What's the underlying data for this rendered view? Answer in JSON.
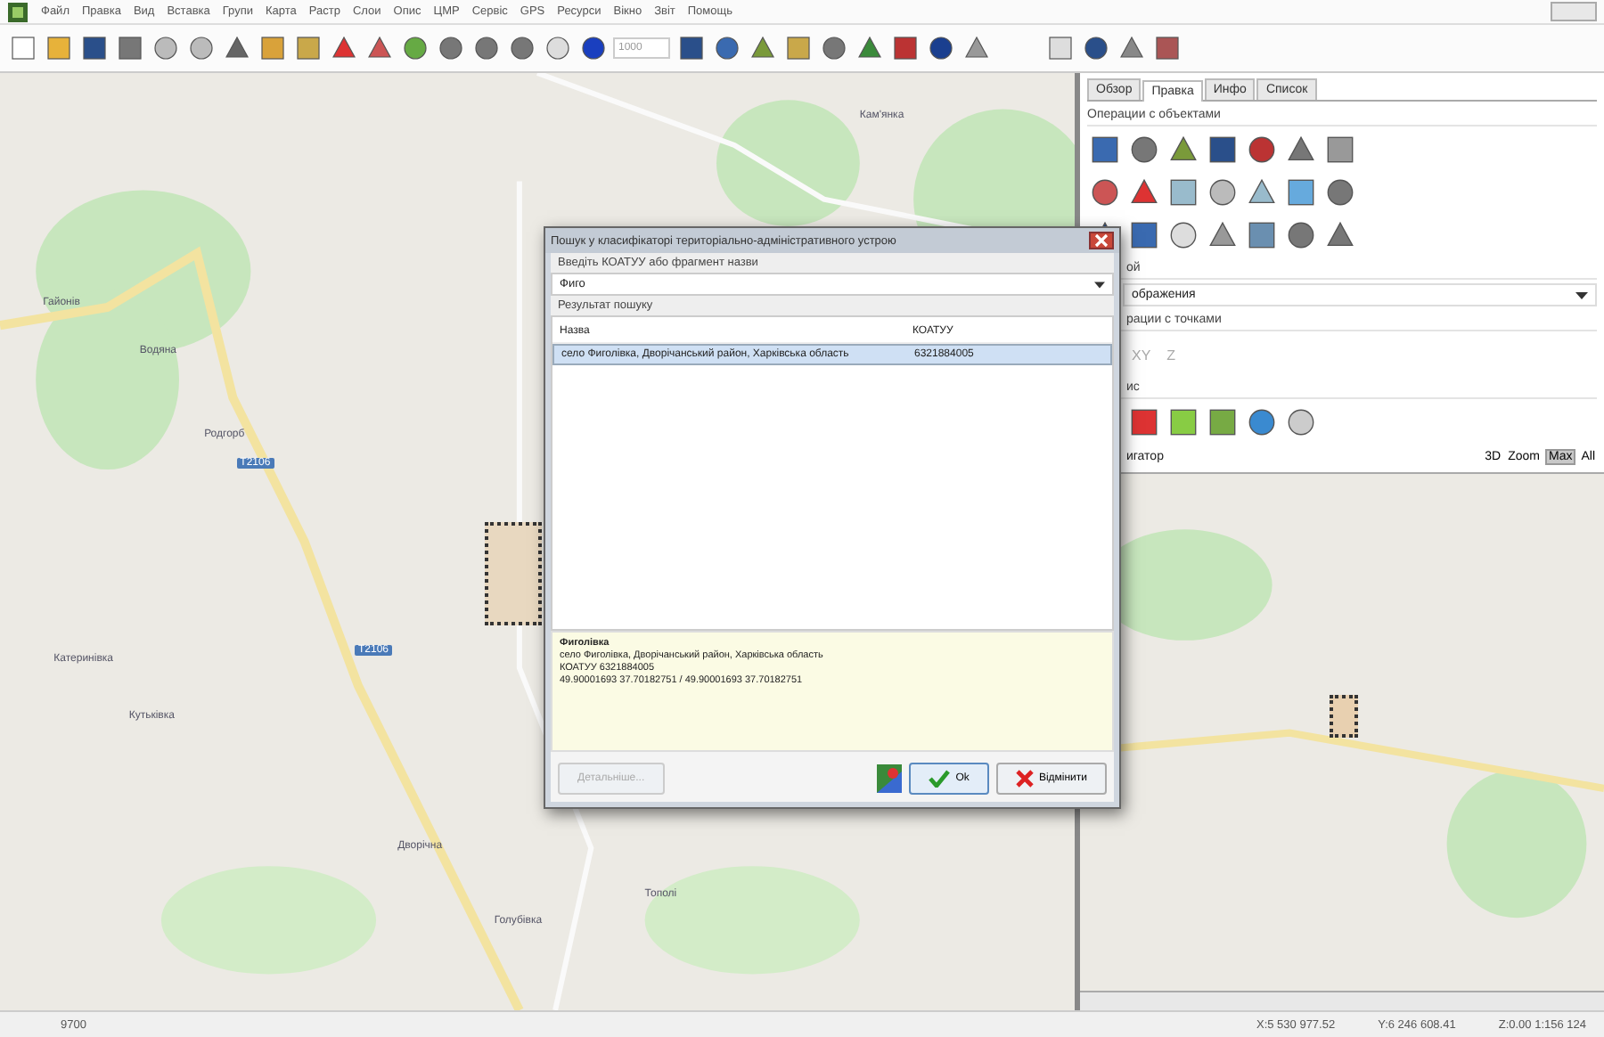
{
  "menu": [
    "Файл",
    "Правка",
    "Вид",
    "Вставка",
    "Групи",
    "Карта",
    "Растр",
    "Слои",
    "Опис",
    "ЦМР",
    "Сервіс",
    "GPS",
    "Ресурси",
    "Вікно",
    "Звіт",
    "Помощь"
  ],
  "toolbar": {
    "scale_field": {
      "value": "1000"
    }
  },
  "map": {
    "labels": [
      {
        "text": "Кам'янка",
        "kind": "place"
      },
      {
        "text": "Гайонів",
        "kind": "place"
      },
      {
        "text": "Водяна",
        "kind": "place"
      },
      {
        "text": "Родгорб",
        "kind": "place"
      },
      {
        "text": "Т2106",
        "kind": "road"
      },
      {
        "text": "Т2106",
        "kind": "road"
      },
      {
        "text": "Катеринівка",
        "kind": "place"
      },
      {
        "text": "Кутьківка",
        "kind": "place"
      },
      {
        "text": "Дворічна",
        "kind": "place"
      },
      {
        "text": "Тополі",
        "kind": "place"
      },
      {
        "text": "Голубівка",
        "kind": "place"
      }
    ]
  },
  "dialog": {
    "title": "Пошук у класифікаторі територіально-адміністративного устрою",
    "input_label": "Введіть КОАТУУ або фрагмент назви",
    "input": {
      "value": "Фиго"
    },
    "results_label": "Результат пошуку",
    "table": {
      "columns": [
        "Назва",
        "КОАТУУ"
      ],
      "rows": [
        {
          "cells": [
            "село Фиголівка, Дворічанський район, Харківська область",
            "6321884005"
          ],
          "selected": true
        }
      ]
    },
    "info": {
      "title": "Фиголівка",
      "lines": [
        "село Фиголівка, Дворічанський район, Харківська область",
        "КОАТУУ 6321884005",
        "49.90001693 37.70182751 / 49.90001693 37.70182751"
      ]
    },
    "buttons": [
      {
        "label": "Детальніше...",
        "kind": "details",
        "disabled": true
      },
      {
        "label": "Ok",
        "kind": "ok",
        "disabled": false
      },
      {
        "label": "Відмінити",
        "kind": "cancel",
        "disabled": false
      }
    ]
  },
  "panel": {
    "tabs": [
      {
        "label": "Обзор",
        "selected": false
      },
      {
        "label": "Правка",
        "selected": true
      },
      {
        "label": "Инфо",
        "selected": false
      },
      {
        "label": "Список",
        "selected": false
      }
    ],
    "objects_label": "Операции с объектами",
    "layer_label": "ой",
    "layer_value": "ображения",
    "points_label": "рации с точками",
    "points_texts": [
      "XY",
      "Z"
    ],
    "service_label": "ис",
    "navigator_label": "игатор",
    "nav_buttons": [
      {
        "label": "3D",
        "selected": false
      },
      {
        "label": "Zoom",
        "selected": false
      },
      {
        "label": "Max",
        "selected": true
      },
      {
        "label": "All",
        "selected": false
      }
    ]
  },
  "status_bar": [
    "9700",
    "X:5 530 977.52",
    "Y:6 246 608.41",
    "Z:0.00 1:156 124"
  ]
}
